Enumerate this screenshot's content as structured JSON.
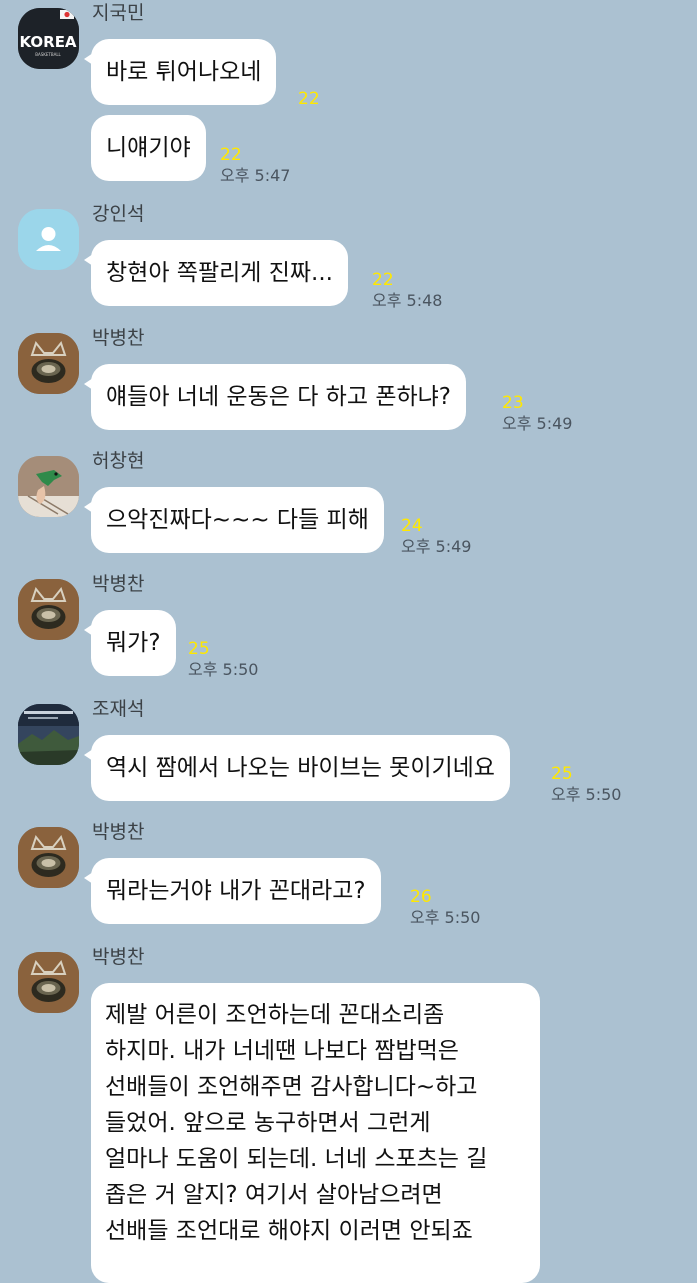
{
  "messages": [
    {
      "sender": "지국민",
      "avatar": "korea-jersey-avatar",
      "bubbles": [
        {
          "text": "바로 튀어나오네",
          "unread": "22"
        },
        {
          "text": "니얘기야",
          "unread": "22",
          "time": "오후 5:47"
        }
      ]
    },
    {
      "sender": "강인석",
      "avatar": "default-person-avatar",
      "bubbles": [
        {
          "text": "창현아 쪽팔리게 진짜...",
          "unread": "22",
          "time": "오후 5:48"
        }
      ]
    },
    {
      "sender": "박병찬",
      "avatar": "cat-bowl-avatar",
      "bubbles": [
        {
          "text": "얘들아 너네 운동은 다 하고 폰하냐?",
          "unread": "23",
          "time": "오후 5:49"
        }
      ]
    },
    {
      "sender": "허창현",
      "avatar": "dinosaur-avatar",
      "bubbles": [
        {
          "text": "으악진짜다~~~ 다들 피해",
          "unread": "24",
          "time": "오후 5:49"
        }
      ]
    },
    {
      "sender": "박병찬",
      "avatar": "cat-bowl-avatar",
      "bubbles": [
        {
          "text": "뭐가?",
          "unread": "25",
          "time": "오후 5:50"
        }
      ]
    },
    {
      "sender": "조재석",
      "avatar": "landscape-avatar",
      "bubbles": [
        {
          "text": "역시 짬에서 나오는 바이브는 못이기네요",
          "unread": "25",
          "time": "오후 5:50"
        }
      ]
    },
    {
      "sender": "박병찬",
      "avatar": "cat-bowl-avatar",
      "bubbles": [
        {
          "text": "뭐라는거야 내가 꼰대라고?",
          "unread": "26",
          "time": "오후 5:50"
        }
      ]
    },
    {
      "sender": "박병찬",
      "avatar": "cat-bowl-avatar",
      "bubbles": [
        {
          "lines": [
            "제발 어른이 조언하는데 꼰대소리좀",
            "하지마. 내가 너네땐 나보다 짬밥먹은",
            "선배들이 조언해주면 감사합니다~하고",
            "들었어. 앞으로 농구하면서 그런게",
            "얼마나 도움이 되는데. 너네 스포츠는 길",
            "좁은 거 알지? 여기서 살아남으려면",
            "선배들 조언대로 해야지 이러면 안되죠"
          ]
        }
      ]
    }
  ],
  "colors": {
    "background": "#abc1d1",
    "bubble": "#ffffff",
    "unread": "#ffe800",
    "time": "#4a5560"
  }
}
